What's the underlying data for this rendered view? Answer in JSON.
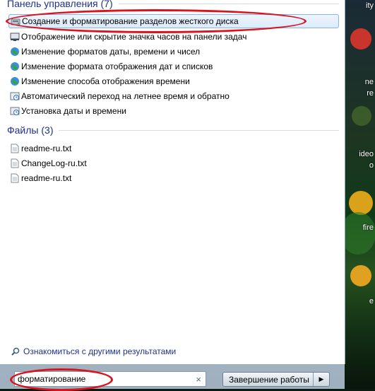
{
  "groups": [
    {
      "header": "Панель управления (7)",
      "items": [
        {
          "label": "Создание и форматирование разделов жесткого диска",
          "icon": "disk-management-icon"
        },
        {
          "label": "Отображение или скрытие значка часов на панели задач",
          "icon": "taskbar-icon"
        },
        {
          "label": "Изменение форматов даты, времени и чисел",
          "icon": "globe-icon"
        },
        {
          "label": "Изменение формата отображения дат и списков",
          "icon": "globe-icon"
        },
        {
          "label": "Изменение способа отображения времени",
          "icon": "globe-icon"
        },
        {
          "label": "Автоматический переход на летнее время и обратно",
          "icon": "clock-settings-icon"
        },
        {
          "label": "Установка даты и времени",
          "icon": "clock-settings-icon"
        }
      ]
    },
    {
      "header": "Файлы (3)",
      "items": [
        {
          "label": "readme-ru.txt",
          "icon": "text-file-icon"
        },
        {
          "label": "ChangeLog-ru.txt",
          "icon": "text-file-icon"
        },
        {
          "label": "readme-ru.txt",
          "icon": "text-file-icon"
        }
      ]
    }
  ],
  "more_results": "Ознакомиться с другими результатами",
  "search": {
    "value": "форматирование",
    "clear": "×"
  },
  "shutdown": {
    "label": "Завершение работы",
    "arrow": "▶"
  },
  "desktop_labels": [
    "ity",
    "ne",
    "re",
    "ideo",
    "o",
    "fire",
    "e"
  ],
  "colors": {
    "highlight_ellipse": "#d9141f",
    "header_text": "#1e3287",
    "selection_border": "#8db2e3"
  }
}
